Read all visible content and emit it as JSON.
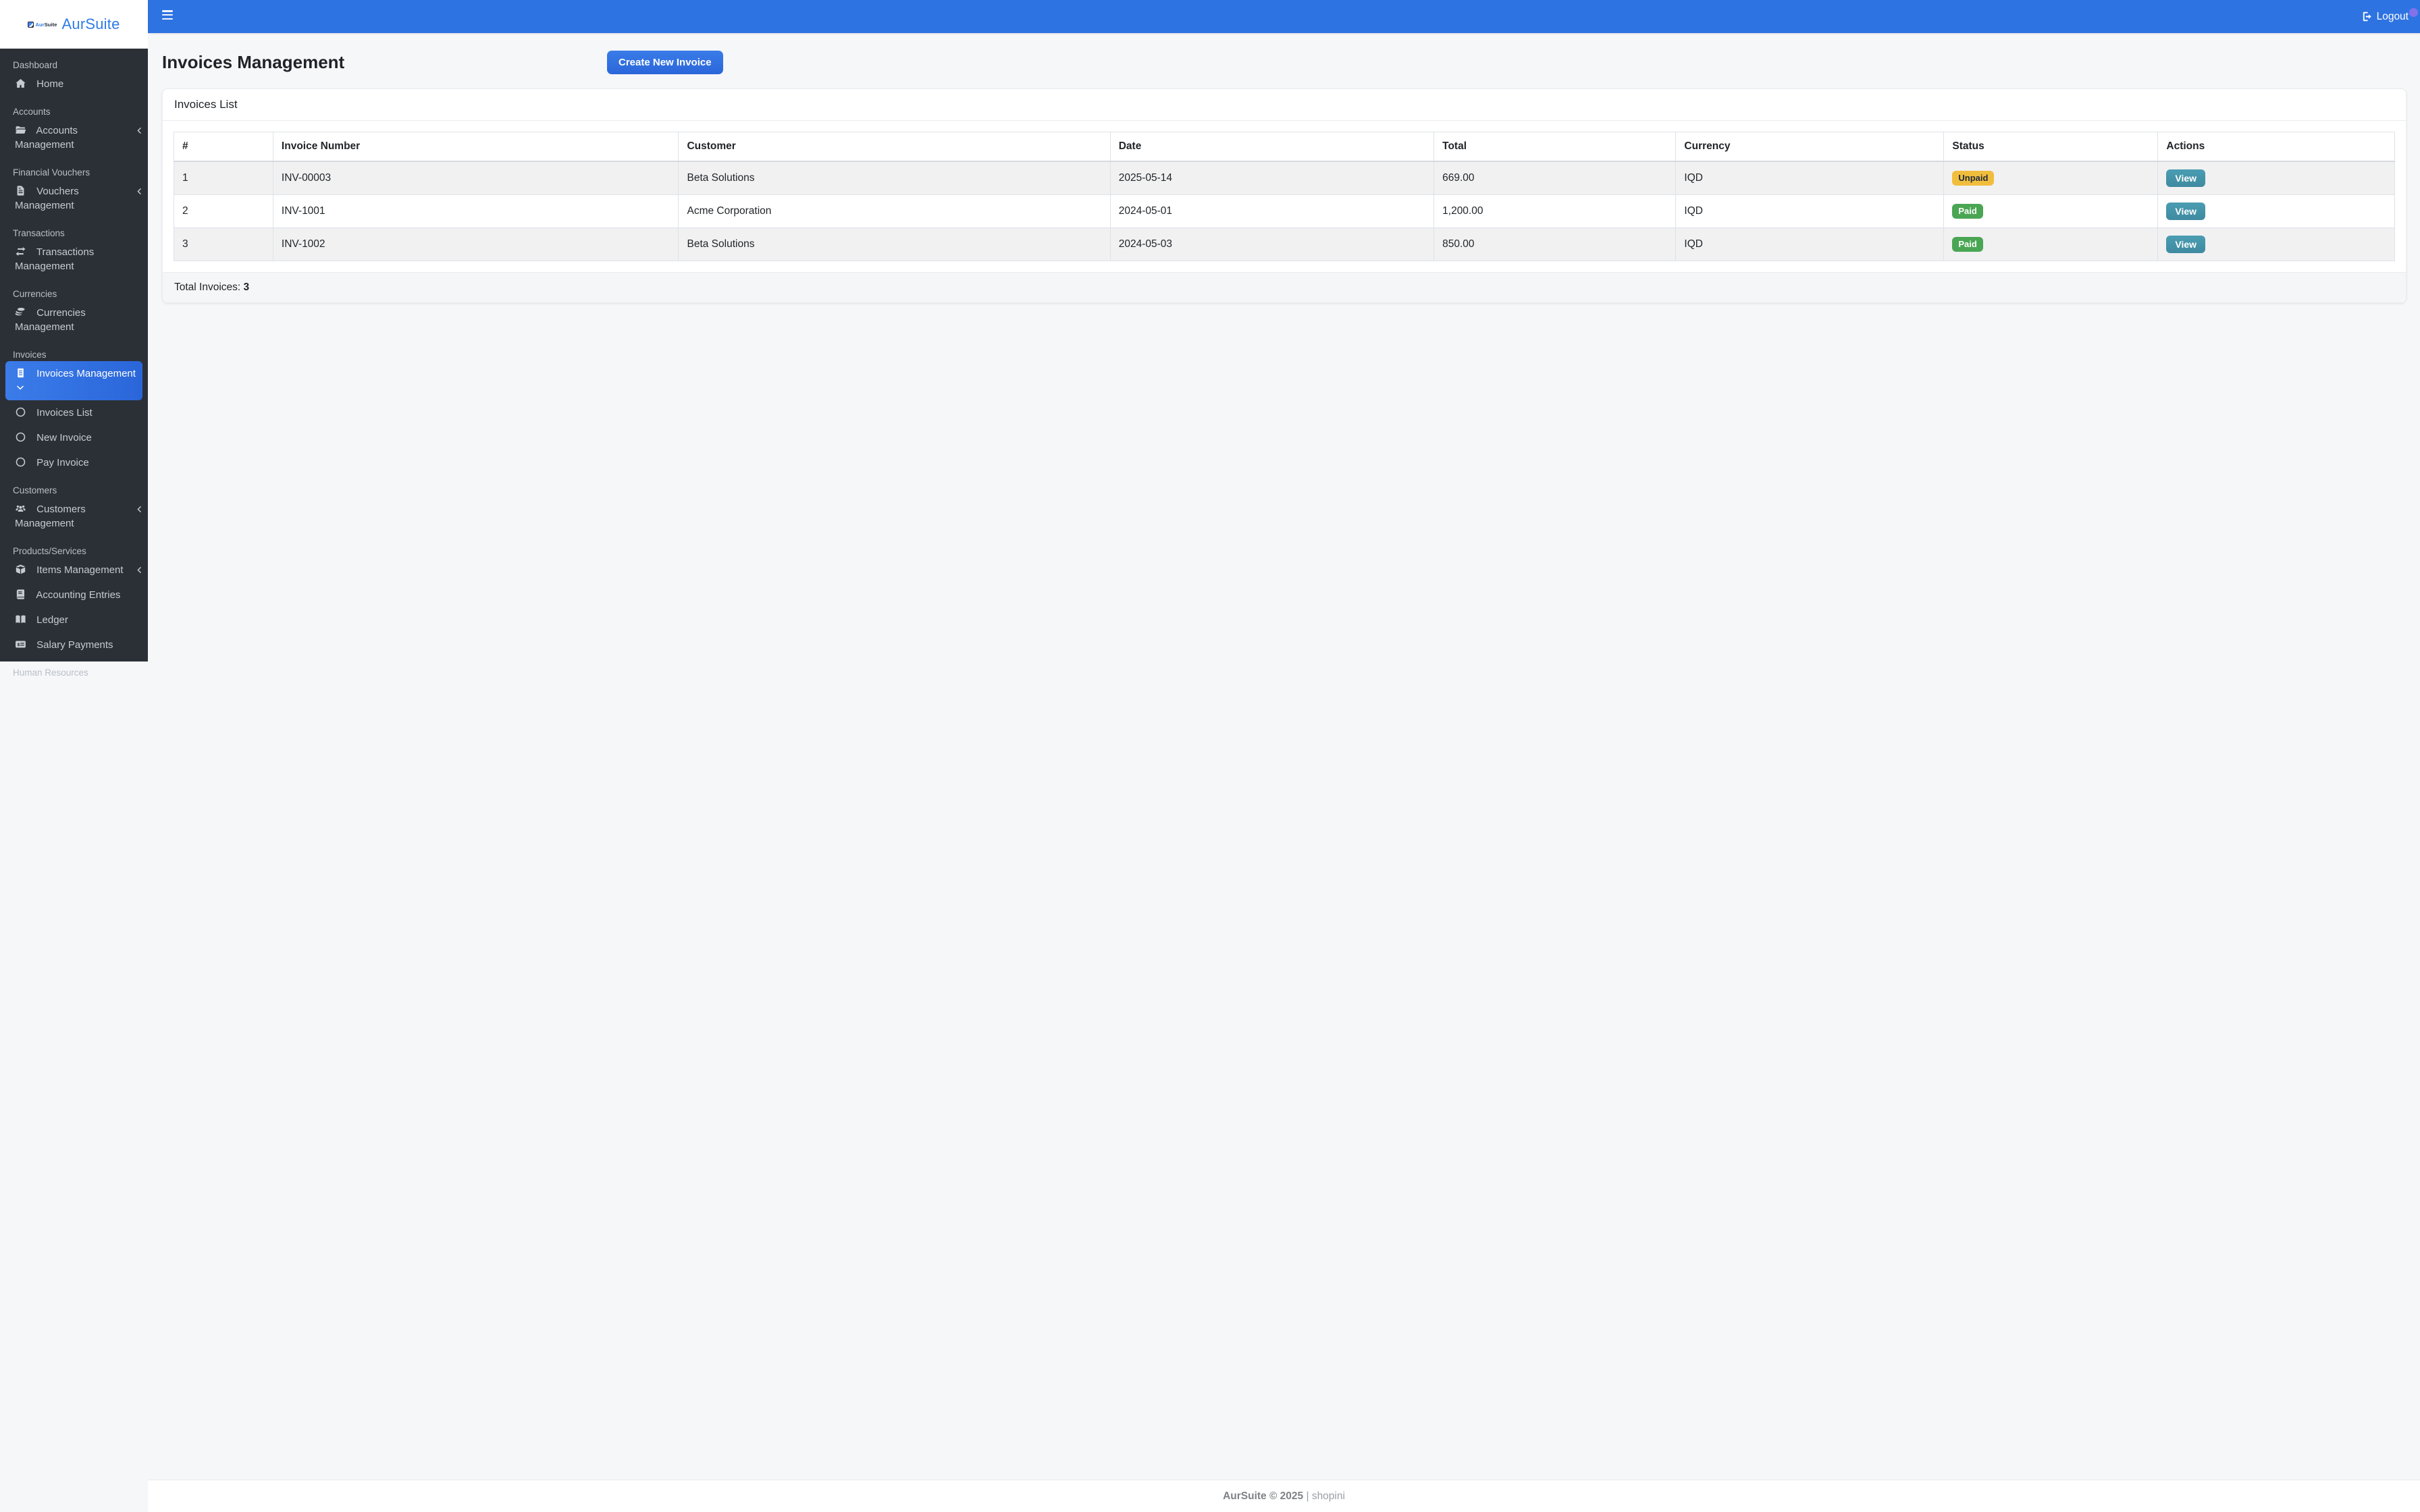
{
  "brand": {
    "name": "AurSuite",
    "mini_prefix": "Aur",
    "mini_suffix": "Suite"
  },
  "navbar": {
    "logout_label": "Logout"
  },
  "page": {
    "title": "Invoices Management",
    "create_button_label": "Create New Invoice"
  },
  "card": {
    "title": "Invoices List",
    "total_label": "Total Invoices:",
    "total_value": "3"
  },
  "table": {
    "columns": [
      "#",
      "Invoice Number",
      "Customer",
      "Date",
      "Total",
      "Currency",
      "Status",
      "Actions"
    ],
    "rows": [
      {
        "num": "1",
        "invoice_number": "INV-00003",
        "customer": "Beta Solutions",
        "date": "2025-05-14",
        "total": "669.00",
        "currency": "IQD",
        "status": "Unpaid",
        "status_variant": "warning",
        "action_label": "View"
      },
      {
        "num": "2",
        "invoice_number": "INV-1001",
        "customer": "Acme Corporation",
        "date": "2024-05-01",
        "total": "1,200.00",
        "currency": "IQD",
        "status": "Paid",
        "status_variant": "success",
        "action_label": "View"
      },
      {
        "num": "3",
        "invoice_number": "INV-1002",
        "customer": "Beta Solutions",
        "date": "2024-05-03",
        "total": "850.00",
        "currency": "IQD",
        "status": "Paid",
        "status_variant": "success",
        "action_label": "View"
      }
    ]
  },
  "sidebar": {
    "sections": [
      {
        "label": "Dashboard",
        "items": [
          {
            "label": "Home",
            "icon": "home"
          }
        ]
      },
      {
        "label": "Accounts",
        "items": [
          {
            "label": "Accounts Management",
            "icon": "folder-open",
            "chevron": "left"
          }
        ]
      },
      {
        "label": "Financial Vouchers",
        "items": [
          {
            "label": "Vouchers Management",
            "icon": "file-invoice",
            "chevron": "left"
          }
        ]
      },
      {
        "label": "Transactions",
        "items": [
          {
            "label": "Transactions Management",
            "icon": "exchange"
          }
        ]
      },
      {
        "label": "Currencies",
        "items": [
          {
            "label": "Currencies Management",
            "icon": "coins"
          }
        ]
      },
      {
        "label": "Invoices",
        "items": [
          {
            "label": "Invoices Management",
            "icon": "receipt",
            "chevron": "down",
            "active": true
          },
          {
            "label": "Invoices List",
            "icon": "circle"
          },
          {
            "label": "New Invoice",
            "icon": "circle"
          },
          {
            "label": "Pay Invoice",
            "icon": "circle"
          }
        ]
      },
      {
        "label": "Customers",
        "items": [
          {
            "label": "Customers Management",
            "icon": "users",
            "chevron": "left"
          }
        ]
      },
      {
        "label": "Products/Services",
        "items": [
          {
            "label": "Items Management",
            "icon": "box",
            "chevron": "left"
          },
          {
            "label": "Accounting Entries",
            "icon": "book"
          },
          {
            "label": "Ledger",
            "icon": "book-open"
          },
          {
            "label": "Salary Payments",
            "icon": "money-check"
          }
        ]
      },
      {
        "label": "Human Resources",
        "items": []
      }
    ]
  },
  "footer": {
    "copyright": "AurSuite © 2025",
    "divider": " | ",
    "credit": "shopini"
  },
  "colors": {
    "accent_blue": "#2e73e2",
    "sidebar_bg": "#2b3037",
    "warning": "#f1bd3d",
    "success": "#4aa653",
    "view_teal": "#4493ab",
    "corner_dot": "#8272ea"
  }
}
